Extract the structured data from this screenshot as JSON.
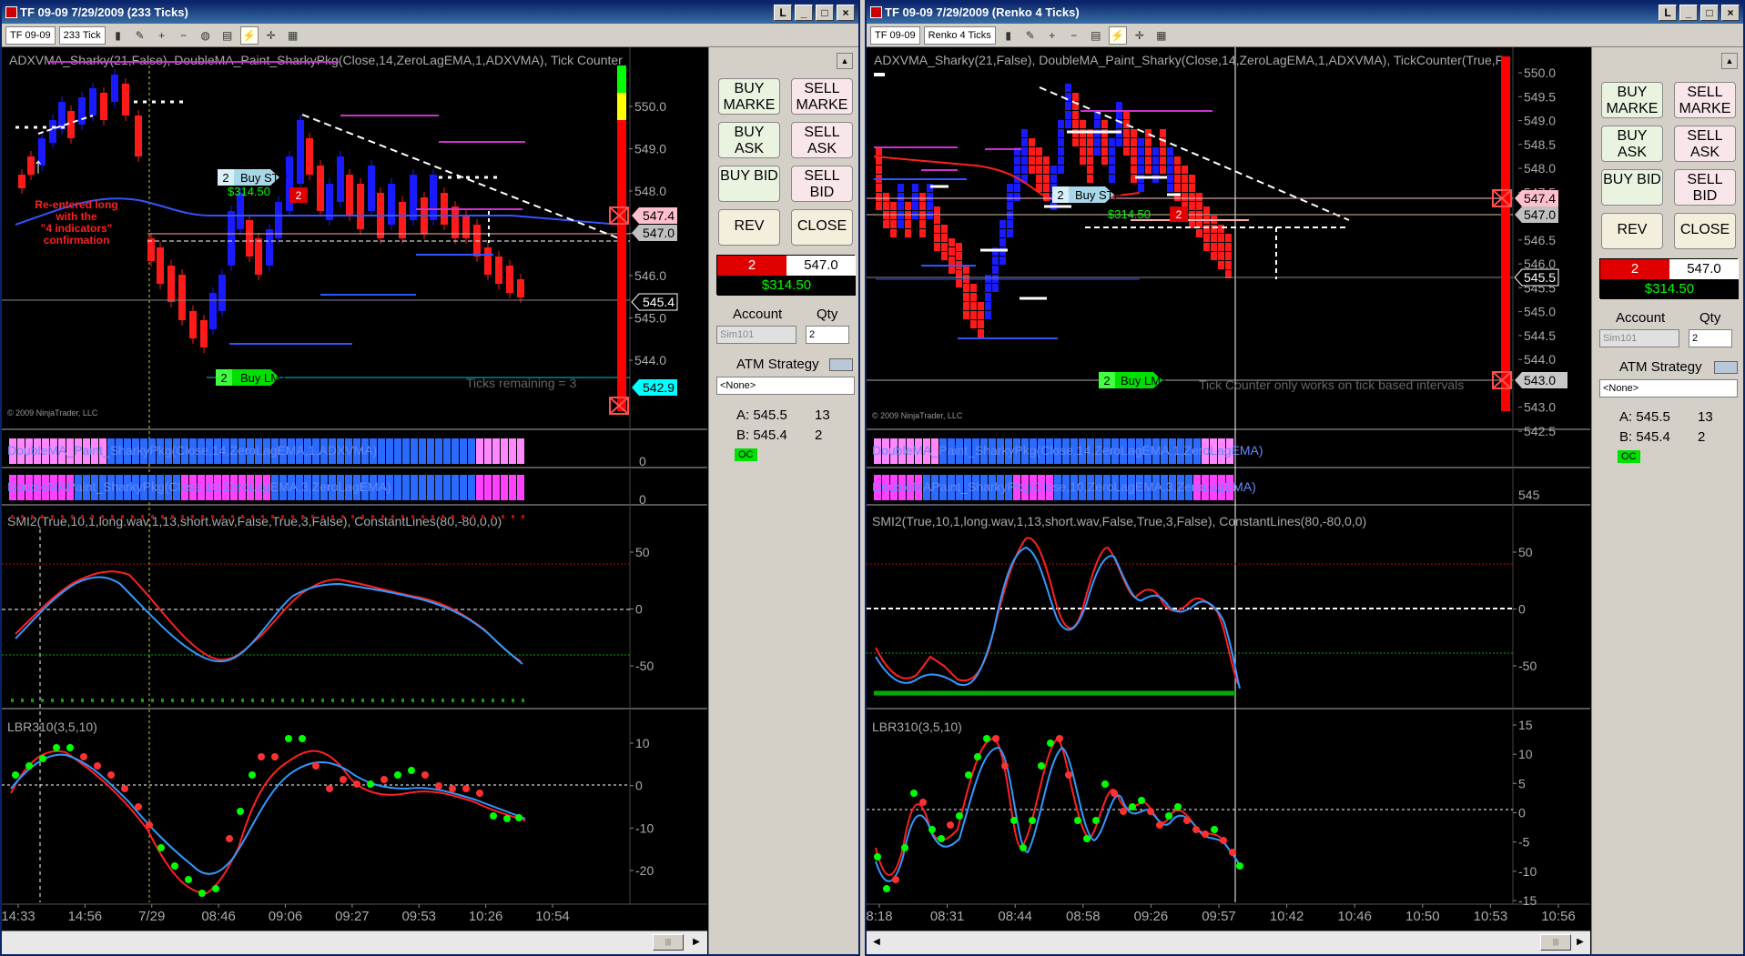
{
  "left": {
    "title": "TF 09-09  7/29/2009 (233 Ticks)",
    "toolbar": {
      "instrument": "TF 09-09",
      "interval": "233 Tick"
    },
    "price_header": "ADXVMA_Sharky(21,False),  DoubleMA_Paint_SharkyPkg(Close,14,ZeroLagEMA,1,ADXVMA),  Tick Counter",
    "price_axis": [
      "550.0",
      "549.0",
      "548.0",
      "547.0",
      "546.0",
      "545.0",
      "544.0"
    ],
    "markers": {
      "ask": "547.4",
      "bid": "547.0",
      "last": "545.4",
      "stop": "542.9"
    },
    "annotation": [
      "Re-entered long",
      "with the",
      "\"4 indicators\"",
      "confirmation"
    ],
    "buy_stp": {
      "qty": "2",
      "label": "Buy STP",
      "pnl": "$314.50",
      "pos": "2"
    },
    "buy_lmt": {
      "qty": "2",
      "label": "Buy LMT"
    },
    "ticks_remaining": "Ticks remaining = 3",
    "copyright": "© 2009 NinjaTrader, LLC",
    "paint1": "DoubleMA_Paint_SharkyPkg(Close,14,ZeroLagEMA,1,ADXVMA)",
    "paint2": "DoubleMAPaint_SharkyPkg(Close,10,ZeroLagEMA,3,ZeroLagEMA)",
    "paint_zero": "0",
    "smi_header": "SMI2(True,10,1,long.wav,1,13,short.wav,False,True,3,False),  ConstantLines(80,-80,0,0)",
    "smi_axis": [
      "50",
      "0",
      "-50"
    ],
    "lbr_header": "LBR310(3,5,10)",
    "lbr_axis": [
      "10",
      "0",
      "-10",
      "-20"
    ],
    "time_axis": [
      "14:33",
      "14:56",
      "7/29",
      "08:46",
      "09:06",
      "09:27",
      "09:53",
      "10:26",
      "10:54"
    ],
    "panel": {
      "buy_market": "BUY MARKE",
      "sell_market": "SELL MARKE",
      "buy_ask": "BUY ASK",
      "sell_ask": "SELL ASK",
      "buy_bid": "BUY BID",
      "sell_bid": "SELL BID",
      "rev": "REV",
      "close": "CLOSE",
      "pos_qty": "2",
      "pos_avg": "547.0",
      "pos_pnl": "$314.50",
      "account_label": "Account",
      "qty_label": "Qty",
      "account": "Sim101",
      "qty": "2",
      "atm_label": "ATM Strategy",
      "atm": "<None>",
      "ask": "A: 545.5",
      "ask_size": "13",
      "bid": "B: 545.4",
      "bid_size": "2",
      "oc": "OC"
    }
  },
  "right": {
    "title": "TF 09-09  7/29/2009 (Renko 4 Ticks)",
    "toolbar": {
      "instrument": "TF 09-09",
      "interval": "Renko 4 Ticks"
    },
    "price_header": "ADXVMA_Sharky(21,False),  DoubleMA_Paint_Sharky(Close,14,ZeroLagEMA,1,ADXVMA),  TickCounter(True,F",
    "price_axis": [
      "550.0",
      "549.5",
      "549.0",
      "548.5",
      "548.0",
      "547.5",
      "547.0",
      "546.5",
      "546.0",
      "545.5",
      "545.0",
      "544.5",
      "544.0",
      "543.5",
      "543.0",
      "542.5"
    ],
    "markers": {
      "ask": "547.4",
      "bid": "547.0",
      "last": "545.5",
      "stop": "543.0"
    },
    "buy_stp": {
      "qty": "2",
      "label": "Buy STP",
      "pnl": "$314.50",
      "pos": "2"
    },
    "buy_lmt": {
      "qty": "2",
      "label": "Buy LMT"
    },
    "tick_msg": "Tick Counter only works on tick based intervals",
    "copyright": "© 2009 NinjaTrader, LLC",
    "paint1": "DoubleMA_Paint_SharkyPkg(Close,14,ZeroLagEMA,1,ZeroLagEMA)",
    "paint2": "DoubleMAPaint_SharkyPkg(Close,10,ZeroLagEMA,3,ZeroLagEMA)",
    "paint_axis": "545",
    "smi_header": "SMI2(True,10,1,long.wav,1,13,short.wav,False,True,3,False),  ConstantLines(80,-80,0,0)",
    "smi_axis": [
      "50",
      "0",
      "-50"
    ],
    "lbr_header": "LBR310(3,5,10)",
    "lbr_axis": [
      "15",
      "10",
      "5",
      "0",
      "-5",
      "-10",
      "-15"
    ],
    "time_axis": [
      "8:18",
      "08:31",
      "08:44",
      "08:58",
      "09:26",
      "09:57",
      "10:42",
      "10:46",
      "10:50",
      "10:53",
      "10:56"
    ],
    "panel": {
      "buy_market": "BUY MARKE",
      "sell_market": "SELL MARKE",
      "buy_ask": "BUY ASK",
      "sell_ask": "SELL ASK",
      "buy_bid": "BUY BID",
      "sell_bid": "SELL BID",
      "rev": "REV",
      "close": "CLOSE",
      "pos_qty": "2",
      "pos_avg": "547.0",
      "pos_pnl": "$314.50",
      "account_label": "Account",
      "qty_label": "Qty",
      "account": "Sim101",
      "qty": "2",
      "atm_label": "ATM Strategy",
      "atm": "<None>",
      "ask": "A: 545.5",
      "ask_size": "13",
      "bid": "B: 545.4",
      "bid_size": "2",
      "oc": "OC"
    }
  },
  "colors": {
    "up": "#1a1aff",
    "down": "#ff1a1a",
    "magenta": "#ff33ff",
    "ask": "#ffc0cb",
    "bid": "#c0c0c0",
    "cyan": "#00ffff",
    "green": "#00ff00"
  }
}
